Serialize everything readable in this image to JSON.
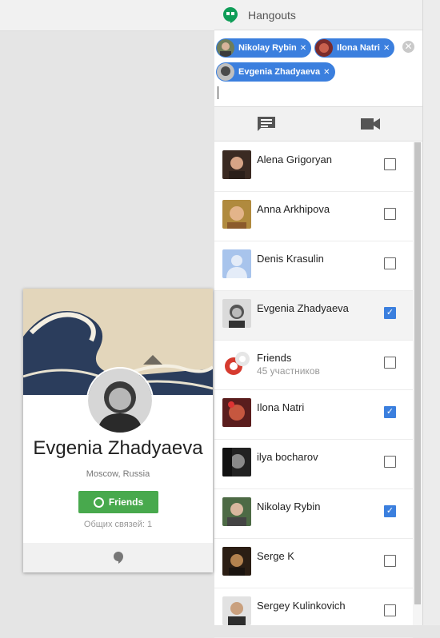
{
  "hangouts": {
    "title": "Hangouts",
    "recipients": [
      {
        "name": "Nikolay Rybin"
      },
      {
        "name": "Ilona Natri"
      },
      {
        "name": "Evgenia Zhadyaeva"
      }
    ]
  },
  "contacts": [
    {
      "name": "Alena Grigoryan",
      "checked": false
    },
    {
      "name": "Anna Arkhipova",
      "checked": false
    },
    {
      "name": "Denis Krasulin",
      "checked": false
    },
    {
      "name": "Evgenia Zhadyaeva",
      "checked": true
    },
    {
      "name": "Friends",
      "subtitle": "45 участников",
      "checked": false
    },
    {
      "name": "Ilona Natri",
      "checked": true
    },
    {
      "name": "ilya bocharov",
      "checked": false
    },
    {
      "name": "Nikolay Rybin",
      "checked": true
    },
    {
      "name": "Serge K",
      "checked": false
    },
    {
      "name": "Sergey Kulinkovich",
      "checked": false
    }
  ],
  "profile": {
    "name": "Evgenia Zhadyaeva",
    "location": "Moscow, Russia",
    "friends_label": "Friends",
    "common": "Общих связей: 1"
  },
  "colors": {
    "chip": "#3b7fde",
    "checkbox_on": "#3b7fde",
    "friends_button": "#48a94d",
    "hangouts_logo": "#0f9d58"
  }
}
